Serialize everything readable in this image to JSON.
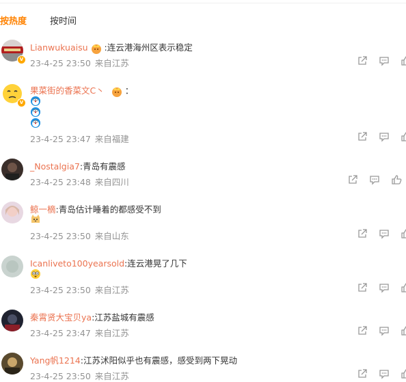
{
  "tabs": {
    "hot": "按热度",
    "time": "按时间"
  },
  "comments": [
    {
      "user": "Lianwukuaisu",
      "text": ":连云港海州区表示稳定",
      "date": "23-4-25 23:50",
      "location": "来自江苏"
    },
    {
      "user": "果菜街的香菜文C丶",
      "text": "：",
      "date": "23-4-25 23:47",
      "location": "来自福建"
    },
    {
      "user": "_Nostalgia7",
      "text": ":青岛有震感",
      "date": "23-4-25 23:48",
      "location": "来自四川"
    },
    {
      "user": "鲸一樀",
      "text": ":青岛估计睡着的都感受不到",
      "date": "23-4-25 23:50",
      "location": "来自山东"
    },
    {
      "user": "Icanliveto100yearsold",
      "text": ":连云港晃了几下",
      "date": "23-4-25 23:50",
      "location": "来自江苏"
    },
    {
      "user": "秦霄贤大宝贝ya",
      "text": ":江苏盐城有震感",
      "date": "23-4-25 23:47",
      "location": "来自江苏"
    },
    {
      "user": "Yang帆1214",
      "text": ":江苏沭阳似乎也有震感，感受到两下晃动",
      "date": "23-4-25 23:50",
      "location": "来自江苏"
    }
  ],
  "icons": [
    "share-icon",
    "comment-icon",
    "like-icon",
    "crown-icon",
    "doraemon-emoji",
    "cat-emoji",
    "shocked-emoji"
  ],
  "colors": {
    "accent": "#ff8200",
    "username": "#eb7350",
    "meta": "#939393",
    "icon": "#999999"
  }
}
